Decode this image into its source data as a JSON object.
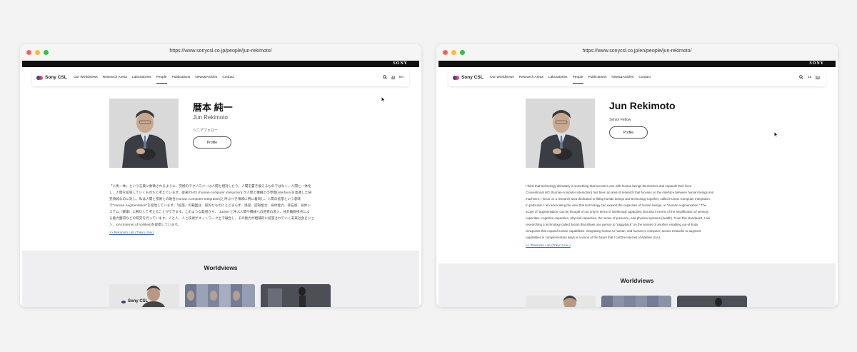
{
  "ja": {
    "url": "https://www.sonycsl.co.jp/people/jun-rekimoto/",
    "sony": "SONY",
    "logo": "Sony CSL",
    "nav": [
      "Our Worldviews",
      "Research Areas",
      "Laboratories",
      "People",
      "Publications",
      "News&Articles",
      "Contact"
    ],
    "lang_ja": "Ja",
    "lang_en": "En",
    "name": "暦本 純一",
    "romaji": "Jun Rekimoto",
    "role": "シニアフェロー",
    "profile_button": "Profile",
    "bio_lines": [
      "「人馬一体」という言葉に象徴されるように、究極のテクノロジーは人間と相対したり、人間を置き換えるものではなく、人間と一体化",
      "し、人間を拡張していくものだと考えています。従来のHCI (human-computer interaction) が人間と機械との界面(interface)を意識した研",
      "究領域なのに対し、私は人間と技術との融合(Human Computer Integration)と呼ぶべき領域に特に着目し、人間の拡張という意味",
      "で\"Human Augmentation\"を提唱しています。「拡張」の範囲は、知的なものにとどまらず、感覚、認知能力、身体能力、存在感、身体シ",
      "ステム（健康）に敷衍して考えることができます。このような発想から、\"Jackin\"と呼ぶ人間や機械への感覚の没入、体外離脱視点によ",
      "る能力獲得などの研究を行っています。人と人、人と技術がネットワーク上で融合し、その能力が相補的に拡張されていく未来社会ビジョ",
      "ン、IoA (Internet of Abilities)を提唱しています。"
    ],
    "lab_link": ">> Rekimoto Lab (Tokyo Univ.)",
    "worldviews": "Worldviews",
    "thumb1_logo": "Sony CSL"
  },
  "en": {
    "url": "https://www.sonycsl.co.jp/en/people/jun-rekimoto/",
    "sony": "SONY",
    "logo": "Sony CSL",
    "nav": [
      "Our Worldviews",
      "Research Areas",
      "Laboratories",
      "People",
      "Publications",
      "News&Articles",
      "Contact"
    ],
    "lang_ja": "Ja",
    "lang_en": "En",
    "name": "Jun Rekimoto",
    "role": "Senior Fellow",
    "profile_button": "Profile",
    "bio_lines": [
      "I think that technology ultimately is something that becomes one with human beings themselves and expands their lives.",
      "Conventional HCI (human-computer interaction) has been an area of research that focuses on the interface between human beings and",
      "machines. I focus on a research area dedicated to fitting human beings and technology together, called Human Computer Integration.",
      "In particular, I am advocating the view that technology can expand the capacities of human beings, or \"Human Augmentation.\" The",
      "scope of 'augmentation' can be thought of not only in terms of intellectual capacities, but also in terms of the amplification of sensory",
      "capacities, cognitive capacities, physical capacities, the sense of presence, and physical systems (health). From this standpoint, I am",
      "researching a technology called Jackin that allows one person to \"piggyback\" on the senses of another, enabling out-of-body",
      "viewpoints that expand human capabilities. Integrating human to human, and human to computer, across networks to augment",
      "capabilities in complementary ways is a vision of the future that I call the Internet of Abilities (IoA)."
    ],
    "lab_link": ">> Rekimoto Lab (Tokyo Univ.)",
    "worldviews": "Worldviews"
  },
  "colors": {
    "dot_close": "#fe5f57",
    "dot_min": "#febc2e",
    "dot_max": "#28c840",
    "link": "#3a6ab8",
    "worldviews_bg": "#efeff1"
  }
}
